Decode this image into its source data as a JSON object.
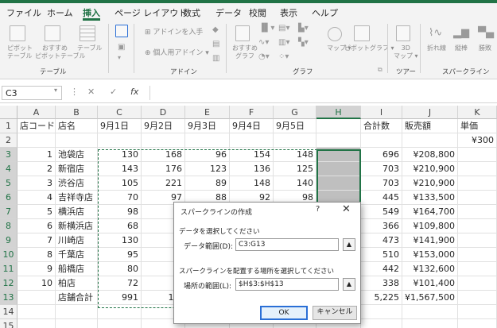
{
  "tabs": [
    "ファイル",
    "ホーム",
    "挿入",
    "ページ レイアウト",
    "数式",
    "データ",
    "校閲",
    "表示",
    "ヘルプ"
  ],
  "active_tab": "挿入",
  "ribbon": {
    "pivot_label1": "ピボット",
    "pivot_label2": "テーブル",
    "recommended_pivot1": "おすすめ",
    "recommended_pivot2": "ピボットテーブル",
    "table_label": "テーブル",
    "group_table": "テーブル",
    "addin_get": "アドインを入手",
    "addin_personal": "個人用アドイン",
    "group_addin": "アドイン",
    "recommended_chart1": "おすすめ",
    "recommended_chart2": "グラフ",
    "map_label": "マップ",
    "pivotchart_label": "ピボットグラフ",
    "group_chart": "グラフ",
    "map3d_label1": "3D",
    "map3d_label2": "マップ",
    "group_tour": "ツアー",
    "sparkline_line": "折れ線",
    "sparkline_column": "縦棒",
    "sparkline_winloss": "勝敗",
    "group_sparkline": "スパークライン"
  },
  "formula_bar": {
    "name_box": "C3",
    "fx": "fx",
    "cancel": "✕",
    "enter": "✓",
    "formula": ""
  },
  "columns": [
    "A",
    "B",
    "C",
    "D",
    "E",
    "F",
    "G",
    "H",
    "I",
    "J",
    "K"
  ],
  "row_numbers": [
    "1",
    "2",
    "3",
    "4",
    "5",
    "6",
    "7",
    "8",
    "9",
    "10",
    "11",
    "12",
    "13",
    "14",
    "15"
  ],
  "header_row": {
    "A": "店コード",
    "B": "店名",
    "C": "9月1日",
    "D": "9月2日",
    "E": "9月3日",
    "F": "9月4日",
    "G": "9月5日",
    "H": "",
    "I": "合計数",
    "J": "販売額",
    "K": "単価"
  },
  "row2_K": "¥300",
  "rows": [
    {
      "A": "1",
      "B": "池袋店",
      "C": "130",
      "D": "168",
      "E": "96",
      "F": "154",
      "G": "148",
      "I": "696",
      "J": "¥208,800"
    },
    {
      "A": "2",
      "B": "新宿店",
      "C": "143",
      "D": "176",
      "E": "123",
      "F": "136",
      "G": "125",
      "I": "703",
      "J": "¥210,900"
    },
    {
      "A": "3",
      "B": "渋谷店",
      "C": "105",
      "D": "221",
      "E": "89",
      "F": "148",
      "G": "140",
      "I": "703",
      "J": "¥210,900"
    },
    {
      "A": "4",
      "B": "吉祥寺店",
      "C": "70",
      "D": "97",
      "E": "88",
      "F": "92",
      "G": "98",
      "I": "445",
      "J": "¥133,500"
    },
    {
      "A": "5",
      "B": "横浜店",
      "C": "98",
      "D": "1",
      "E": "",
      "F": "",
      "G": "",
      "I": "549",
      "J": "¥164,700"
    },
    {
      "A": "6",
      "B": "新横浜店",
      "C": "68",
      "D": "",
      "E": "",
      "F": "",
      "G": "",
      "I": "366",
      "J": "¥109,800"
    },
    {
      "A": "7",
      "B": "川崎店",
      "C": "130",
      "D": "",
      "E": "",
      "F": "",
      "G": "",
      "I": "473",
      "J": "¥141,900"
    },
    {
      "A": "8",
      "B": "千葉店",
      "C": "95",
      "D": "1",
      "E": "",
      "F": "",
      "G": "",
      "I": "510",
      "J": "¥153,000"
    },
    {
      "A": "9",
      "B": "船橋店",
      "C": "80",
      "D": "",
      "E": "",
      "F": "",
      "G": "",
      "I": "442",
      "J": "¥132,600"
    },
    {
      "A": "10",
      "B": "柏店",
      "C": "72",
      "D": "",
      "E": "",
      "F": "",
      "G": "",
      "I": "338",
      "J": "¥101,400"
    }
  ],
  "total_row": {
    "A": "",
    "B": "店舗合計",
    "C": "991",
    "D": "1,2",
    "E": "",
    "F": "",
    "G": "",
    "I": "5,225",
    "J": "¥1,567,500"
  },
  "dialog": {
    "title": "スパークラインの作成",
    "help": "?",
    "close": "✕",
    "section_data": "データを選択してください",
    "data_range_label": "データ範囲(D):",
    "data_range_value": "C3:G13",
    "section_location": "スパークラインを配置する場所を選択してください",
    "location_label": "場所の範囲(L):",
    "location_value": "$H$3:$H$13",
    "ok": "OK",
    "cancel": "キャンセル"
  },
  "colors": {
    "accent": "#217346",
    "selection": "#bfbfbf",
    "ok_border": "#2a6fd6"
  }
}
